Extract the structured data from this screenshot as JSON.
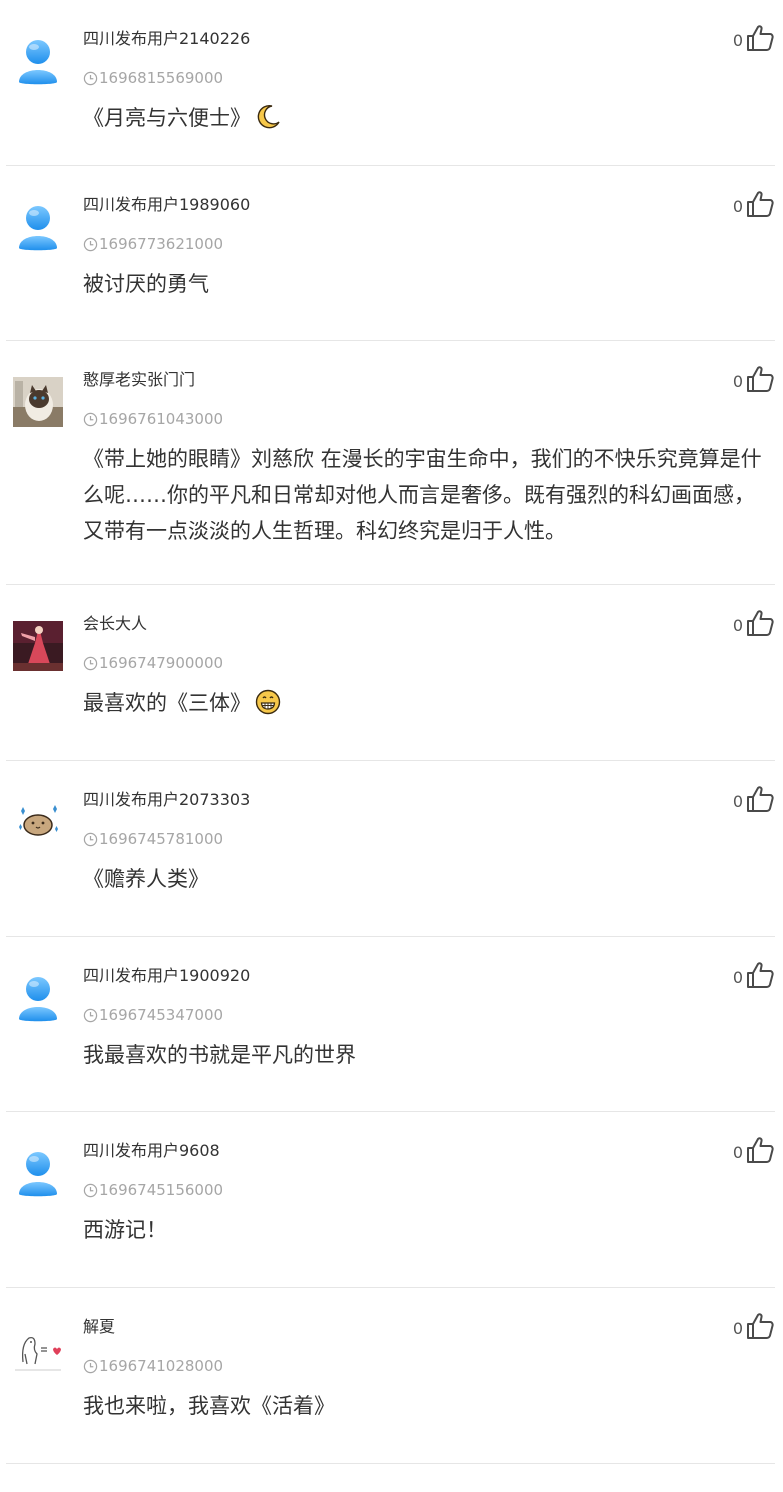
{
  "comments": [
    {
      "username": "四川发布用户2140226",
      "timestamp": "1696815569000",
      "content": "《月亮与六便士》",
      "emoji": "crescent-moon",
      "likes": "0",
      "avatar": "default-user-avatar"
    },
    {
      "username": "四川发布用户1989060",
      "timestamp": "1696773621000",
      "content": "被讨厌的勇气",
      "emoji": null,
      "likes": "0",
      "avatar": "default-user-avatar"
    },
    {
      "username": "憨厚老实张门门",
      "timestamp": "1696761043000",
      "content": "《带上她的眼睛》刘慈欣 在漫长的宇宙生命中，我们的不快乐究竟算是什么呢……你的平凡和日常却对他人而言是奢侈。既有强烈的科幻画面感，又带有一点淡淡的人生哲理。科幻终究是归于人性。",
      "emoji": null,
      "likes": "0",
      "avatar": "cat-photo-avatar"
    },
    {
      "username": "会长大人",
      "timestamp": "1696747900000",
      "content": "最喜欢的《三体》",
      "emoji": "grinning-face",
      "likes": "0",
      "avatar": "stage-photo-avatar"
    },
    {
      "username": "四川发布用户2073303",
      "timestamp": "1696745781000",
      "content": "《赡养人类》",
      "emoji": null,
      "likes": "0",
      "avatar": "cartoon-hamster-avatar"
    },
    {
      "username": "四川发布用户1900920",
      "timestamp": "1696745347000",
      "content": "我最喜欢的书就是平凡的世界",
      "emoji": null,
      "likes": "0",
      "avatar": "default-user-avatar"
    },
    {
      "username": "四川发布用户9608",
      "timestamp": "1696745156000",
      "content": "西游记！",
      "emoji": null,
      "likes": "0",
      "avatar": "default-user-avatar"
    },
    {
      "username": "解夏",
      "timestamp": "1696741028000",
      "content": "我也来啦，我喜欢《活着》",
      "emoji": null,
      "likes": "0",
      "avatar": "sketch-drawing-avatar"
    }
  ]
}
